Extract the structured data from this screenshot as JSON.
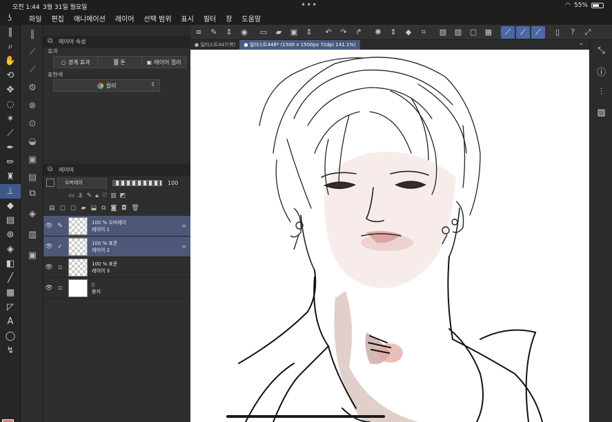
{
  "status": {
    "time": "오전 1:44",
    "date": "3월 31일 월요일",
    "battery": "55%",
    "battery_level": 0.55
  },
  "menu": [
    "파일",
    "편집",
    "애니메이션",
    "레이어",
    "선택 범위",
    "표시",
    "필터",
    "창",
    "도움말"
  ],
  "layer_property": {
    "title": "레이어 속성",
    "effect_label": "효과",
    "effects": [
      "경계 효과",
      "톤",
      "레이어 컬러"
    ],
    "expression_label": "표현색",
    "expression_value": "컬러"
  },
  "layer_panel": {
    "title": "레이어",
    "blend_mode": "오버레이",
    "opacity": "100",
    "layers": [
      {
        "opacity_blend": "100 % 오버레이",
        "name": "레이어 1",
        "selected": true,
        "mark": "pen"
      },
      {
        "opacity_blend": "100 % 표준",
        "name": "레이어 2",
        "selected": true,
        "mark": "check"
      },
      {
        "opacity_blend": "100 % 표준",
        "name": "레이어 3",
        "selected": false,
        "mark": ""
      },
      {
        "opacity_blend": "",
        "name": "용지",
        "selected": false,
        "mark": ""
      }
    ]
  },
  "tabs": [
    {
      "label": "일러스트447(복)",
      "active": false
    },
    {
      "label": "일러스트448* (1500 x 1500px 72dpi 141.1%)",
      "active": true
    }
  ],
  "colors": {
    "main": "#d47c78",
    "sub": "#ffffff",
    "accent": "#4a6aa5"
  }
}
